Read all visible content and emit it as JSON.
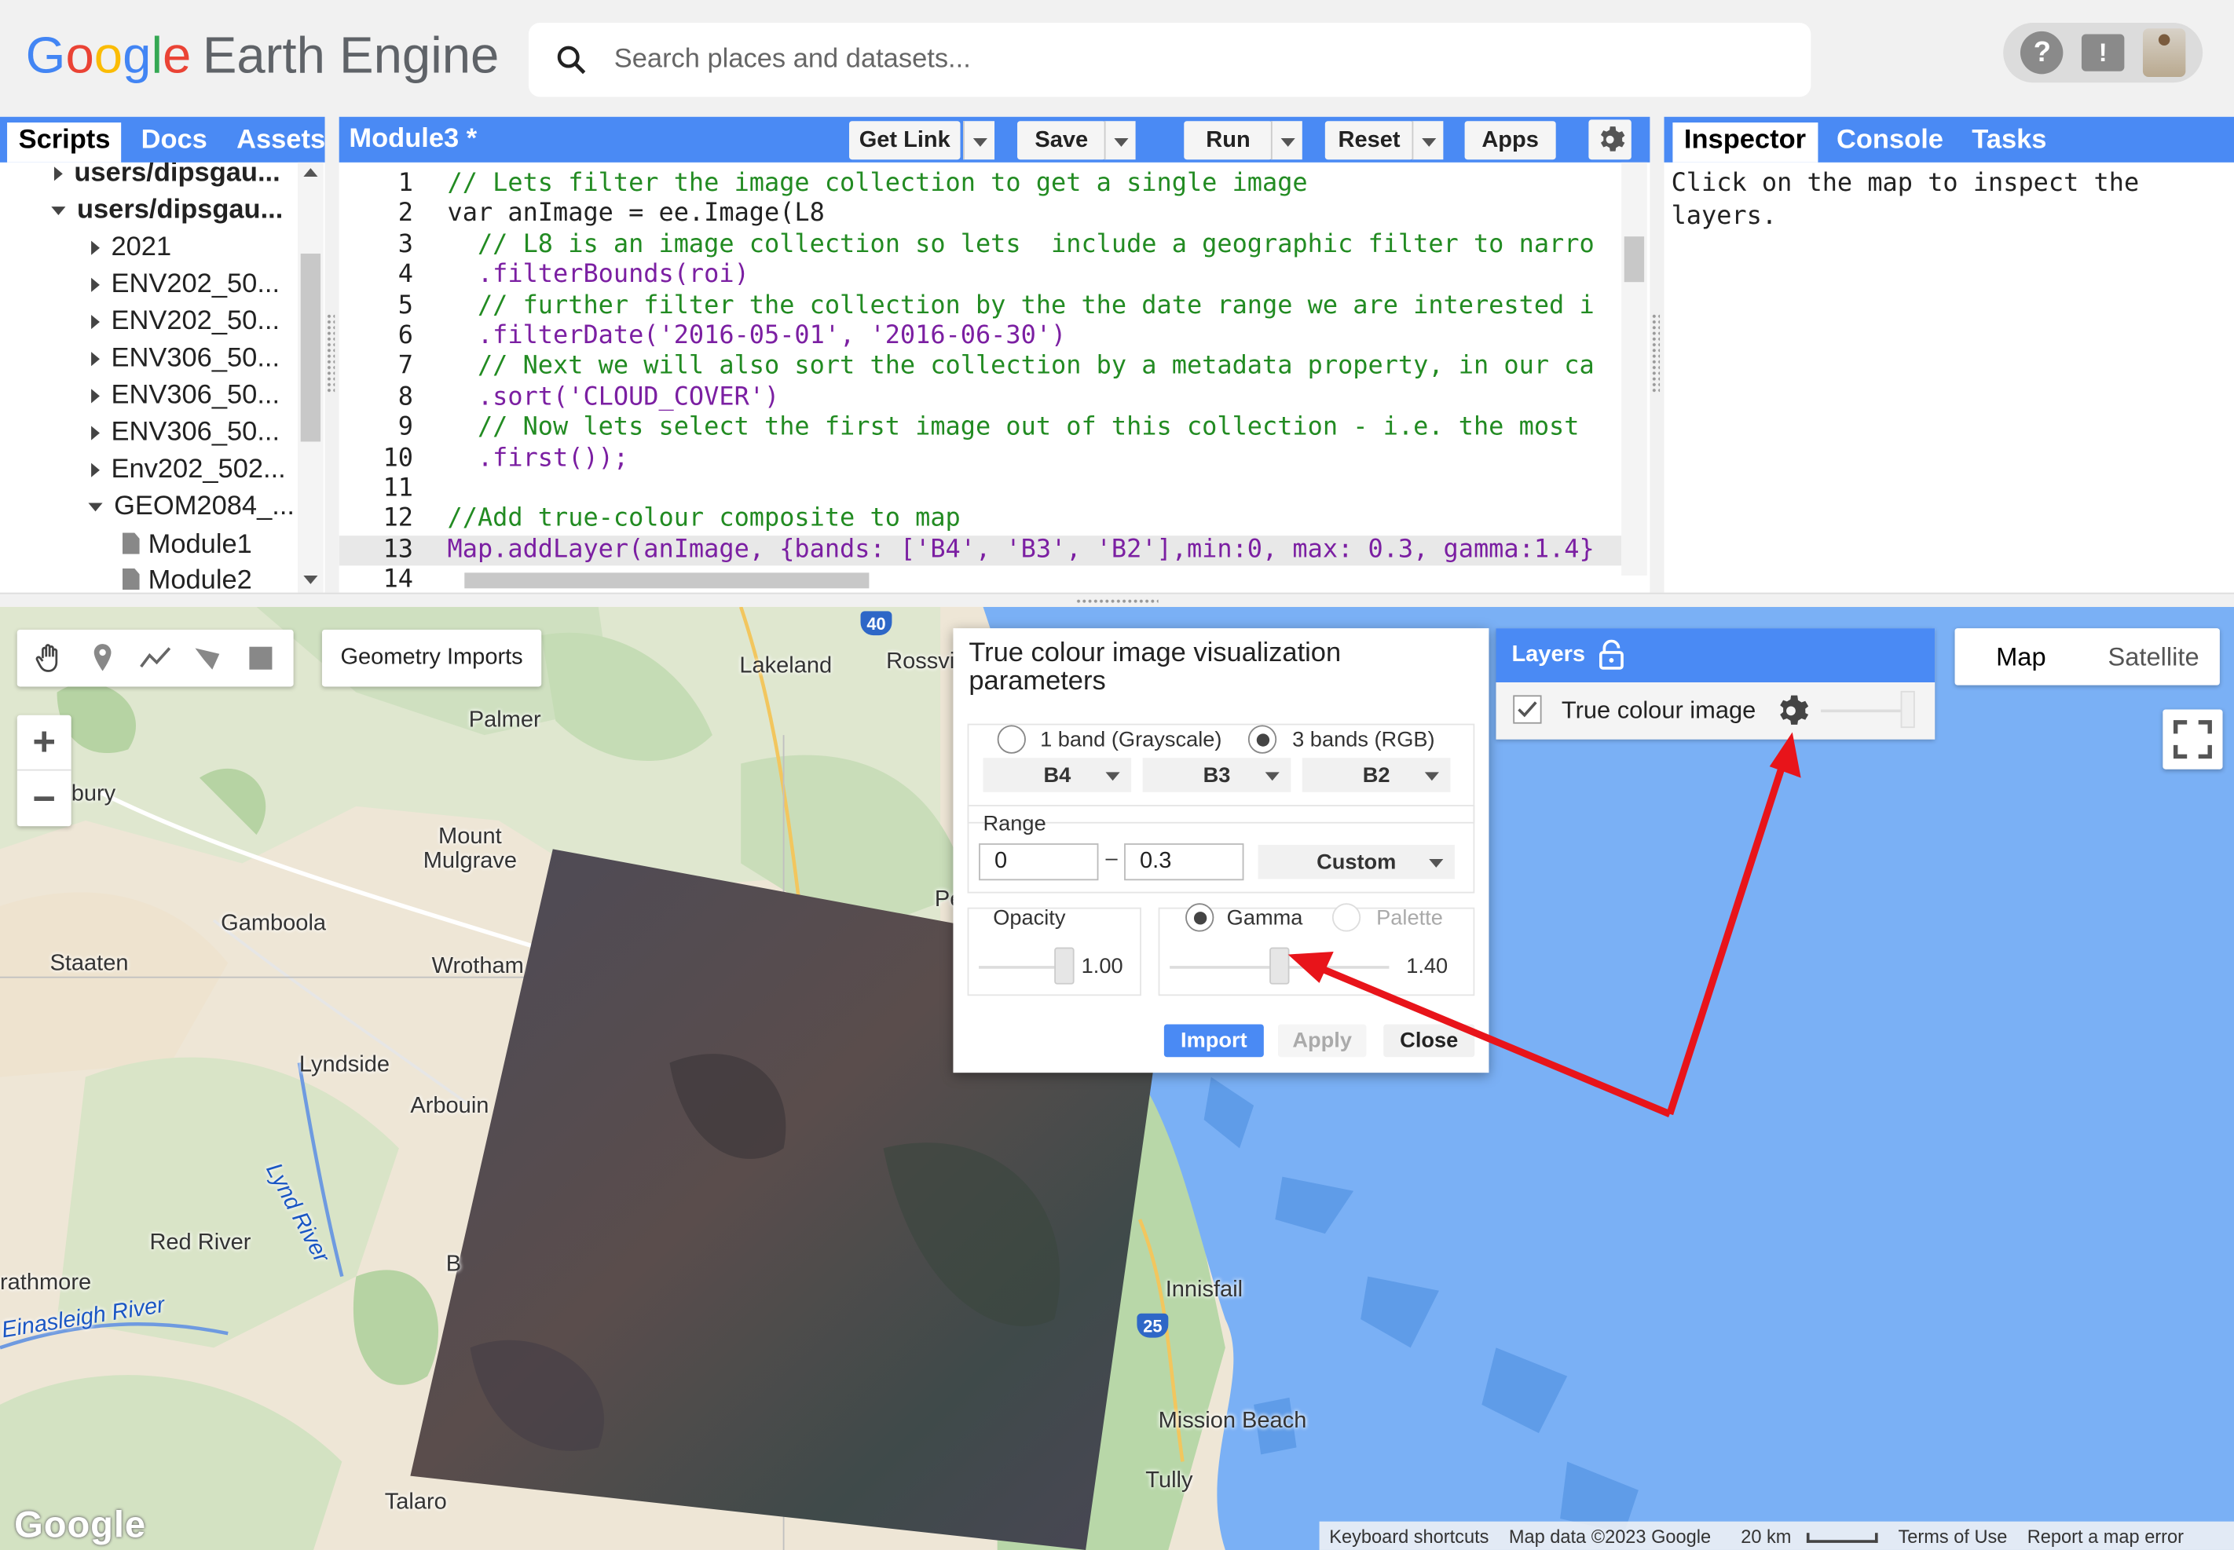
{
  "header": {
    "logo_google": [
      "G",
      "o",
      "o",
      "g",
      "l",
      "e"
    ],
    "logo_product": "Earth Engine",
    "search": {
      "placeholder": "Search places and datasets..."
    },
    "help_icon": "?",
    "feedback_icon": "!"
  },
  "left_panel": {
    "tabs": [
      {
        "label": "Scripts"
      },
      {
        "label": "Docs"
      },
      {
        "label": "Assets"
      }
    ],
    "tree": [
      {
        "label": "users/dipsgau...",
        "bold": true
      },
      {
        "label": "users/dipsgau...",
        "bold": true
      },
      {
        "label": "2021"
      },
      {
        "label": "ENV202_50..."
      },
      {
        "label": "ENV202_50..."
      },
      {
        "label": "ENV306_50..."
      },
      {
        "label": "ENV306_50..."
      },
      {
        "label": "ENV306_50..."
      },
      {
        "label": "Env202_502..."
      },
      {
        "label": "GEOM2084_..."
      },
      {
        "label": "Module1"
      },
      {
        "label": "Module2"
      }
    ]
  },
  "editor": {
    "title": "Module3 *",
    "buttons": {
      "get_link": "Get Link",
      "save": "Save",
      "run": "Run",
      "reset": "Reset",
      "apps": "Apps"
    },
    "line_numbers": [
      "1",
      "2",
      "3",
      "4",
      "5",
      "6",
      "7",
      "8",
      "9",
      "10",
      "11",
      "12",
      "13",
      "14"
    ],
    "lines": [
      "// Lets filter the image collection to get a single image",
      "var anImage = ee.Image(L8",
      "  // L8 is an image collection so lets  include a geographic filter to narro",
      "  .filterBounds(roi)",
      "  // further filter the collection by the the date range we are interested i",
      "  .filterDate('2016-05-01', '2016-06-30')",
      "  // Next we will also sort the collection by a metadata property, in our ca",
      "  .sort('CLOUD_COVER')",
      "  // Now lets select the first image out of this collection - i.e. the most",
      "  .first());",
      "",
      "//Add true-colour composite to map",
      "Map.addLayer(anImage, {bands: ['B4', 'B3', 'B2'],min:0, max: 0.3, gamma:1.4}",
      ""
    ]
  },
  "right_panel": {
    "tabs": [
      {
        "label": "Inspector"
      },
      {
        "label": "Console"
      },
      {
        "label": "Tasks"
      }
    ],
    "inspector_text": "Click on the map to inspect the layers."
  },
  "map": {
    "tools": {
      "geometry_imports": "Geometry Imports"
    },
    "zoom": {
      "in": "+",
      "out": "−"
    },
    "places": [
      {
        "name": "Lakeland"
      },
      {
        "name": "Rossvi"
      },
      {
        "name": "Palmer"
      },
      {
        "name": "bury"
      },
      {
        "name": "Mount\nMulgrave"
      },
      {
        "name": "Gamboola"
      },
      {
        "name": "Staaten"
      },
      {
        "name": "Wrotham"
      },
      {
        "name": "Lyndside"
      },
      {
        "name": "Arbouin"
      },
      {
        "name": "Red River"
      },
      {
        "name": "rathmore"
      },
      {
        "name": "Innisfail"
      },
      {
        "name": "Mission Beach"
      },
      {
        "name": "Tully"
      },
      {
        "name": "Talaro"
      },
      {
        "name": "Pe"
      },
      {
        "name": "B"
      }
    ],
    "water_labels": [
      {
        "name": "Einasleigh River"
      },
      {
        "name": "Lynd River"
      }
    ],
    "route_shields": [
      {
        "label": "40"
      },
      {
        "label": "25"
      }
    ],
    "maptype": {
      "map": "Map",
      "satellite": "Satellite"
    },
    "footer": {
      "shortcuts": "Keyboard shortcuts",
      "map_data": "Map data ©2023 Google",
      "scale": "20 km",
      "terms": "Terms of Use",
      "report": "Report a map error"
    },
    "google_watermark": "Google"
  },
  "vis_dialog": {
    "title": "True colour image visualization parameters",
    "band_mode_1": "1 band (Grayscale)",
    "band_mode_3": "3 bands (RGB)",
    "band_mode_selected": "3 bands (RGB)",
    "bands": [
      "B4",
      "B3",
      "B2"
    ],
    "range_label": "Range",
    "range_min": "0",
    "range_dash": "–",
    "range_max": "0.3",
    "range_mode": "Custom",
    "opacity_label": "Opacity",
    "opacity_value": "1.00",
    "opacity_level": 1.0,
    "gamma_label": "Gamma",
    "palette_label": "Palette",
    "gamma_value": "1.40",
    "gamma_level": 0.5,
    "buttons": {
      "import": "Import",
      "apply": "Apply",
      "close": "Close"
    }
  },
  "layers_panel": {
    "title": "Layers",
    "layers": [
      {
        "name": "True colour image",
        "checked": true
      }
    ]
  },
  "colors": {
    "accent_blue": "#4a8af4",
    "water": "#7ab0f5",
    "annotation_red": "#e8141a"
  }
}
